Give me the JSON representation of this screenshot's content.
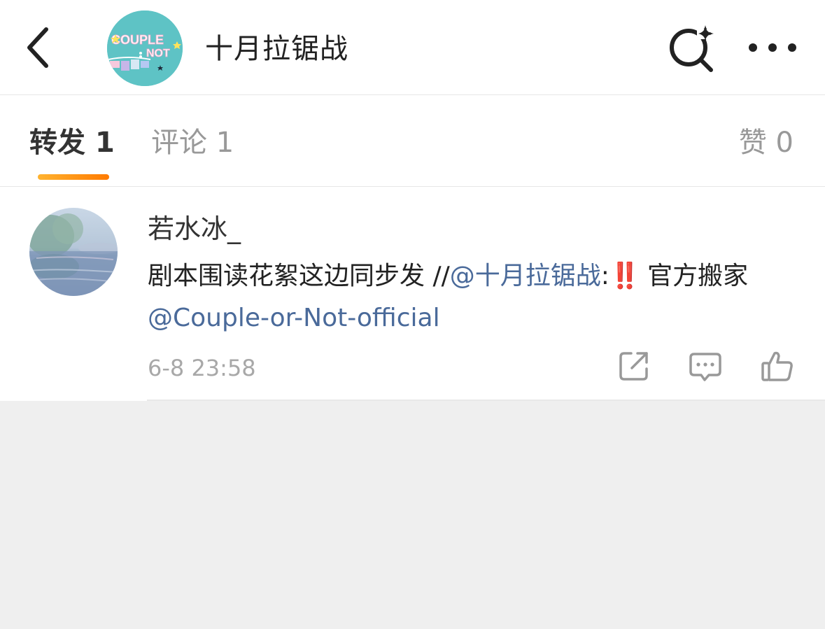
{
  "header": {
    "title": "十月拉锯战",
    "avatar_text_top": "COUPLE",
    "avatar_text_bottom": "NOT",
    "icons": {
      "back": "chevron-left-icon",
      "search": "search-sparkle-icon",
      "more": "more-dots-icon"
    }
  },
  "tabs": {
    "repost": {
      "label": "转发",
      "count": "1"
    },
    "comment": {
      "label": "评论",
      "count": "1"
    },
    "like": {
      "label": "赞",
      "count": "0"
    },
    "accent_color": "#ff8a00"
  },
  "post": {
    "username": "若水冰_",
    "text_before": "剧本围读花絮这边同步发 //",
    "mention_1": "@十月拉锯战",
    "colon": ":",
    "emoji": "‼️",
    "text_after": "官方搬家",
    "mention_2": "@Couple-or-Not-official",
    "timestamp": "6-8 23:58",
    "link_color": "#4a6a9a",
    "actions": {
      "share": "share-icon",
      "comment": "comment-icon",
      "like": "thumbs-up-icon"
    }
  }
}
